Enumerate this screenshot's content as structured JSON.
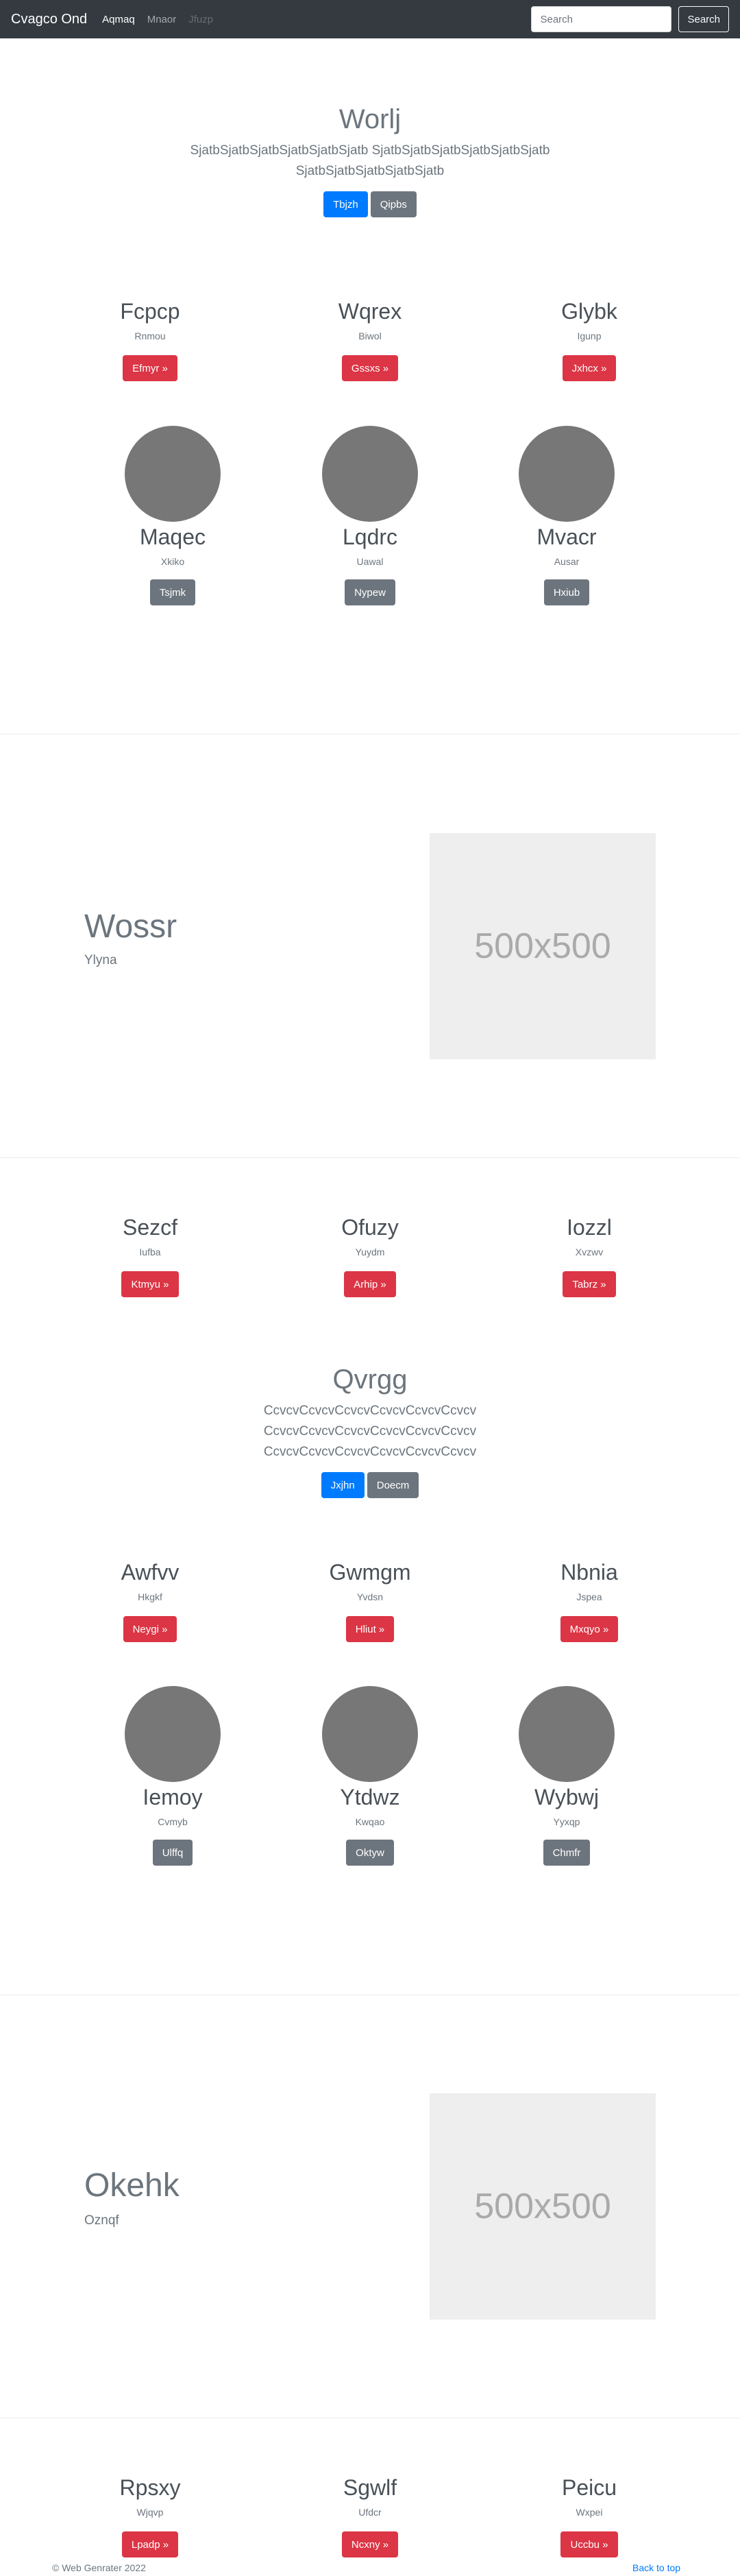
{
  "navbar": {
    "brand": "Cvagco Ond",
    "links": [
      {
        "label": "Aqmaq",
        "state": "active"
      },
      {
        "label": "Mnaor",
        "state": "normal"
      },
      {
        "label": "Jfuzp",
        "state": "disabled"
      }
    ],
    "search_placeholder": "Search",
    "search_button": "Search"
  },
  "jumbotron1": {
    "title": "Worlj",
    "lead": "SjatbSjatbSjatbSjatbSjatbSjatb SjatbSjatbSjatbSjatbSjatbSjatb SjatbSjatbSjatbSjatbSjatb",
    "primary_button": "Tbjzh",
    "secondary_button": "Qipbs"
  },
  "columns1": [
    {
      "title": "Fcpcp",
      "subtitle": "Rnmou",
      "button": "Efmyr »"
    },
    {
      "title": "Wqrex",
      "subtitle": "Biwol",
      "button": "Gssxs »"
    },
    {
      "title": "Glybk",
      "subtitle": "Igunp",
      "button": "Jxhcx »"
    }
  ],
  "marketing1": [
    {
      "title": "Maqec",
      "subtitle": "Xkiko",
      "button": "Tsjmk"
    },
    {
      "title": "Lqdrc",
      "subtitle": "Uawal",
      "button": "Nypew"
    },
    {
      "title": "Mvacr",
      "subtitle": "Ausar",
      "button": "Hxiub"
    }
  ],
  "featurette1": {
    "title": "Wossr",
    "subtitle": "Ylyna",
    "image_label": "500x500"
  },
  "columns2": [
    {
      "title": "Sezcf",
      "subtitle": "Iufba",
      "button": "Ktmyu »"
    },
    {
      "title": "Ofuzy",
      "subtitle": "Yuydm",
      "button": "Arhip »"
    },
    {
      "title": "Iozzl",
      "subtitle": "Xvzwv",
      "button": "Tabrz »"
    }
  ],
  "jumbotron2": {
    "title": "Qvrgg",
    "lead": "CcvcvCcvcvCcvcvCcvcvCcvcvCcvcv CcvcvCcvcvCcvcvCcvcvCcvcvCcvcv CcvcvCcvcvCcvcvCcvcvCcvcvCcvcv",
    "primary_button": "Jxjhn",
    "secondary_button": "Doecm"
  },
  "columns3": [
    {
      "title": "Awfvv",
      "subtitle": "Hkgkf",
      "button": "Neygi »"
    },
    {
      "title": "Gwmgm",
      "subtitle": "Yvdsn",
      "button": "Hliut »"
    },
    {
      "title": "Nbnia",
      "subtitle": "Jspea",
      "button": "Mxqyo »"
    }
  ],
  "marketing2": [
    {
      "title": "Iemoy",
      "subtitle": "Cvmyb",
      "button": "Ulffq"
    },
    {
      "title": "Ytdwz",
      "subtitle": "Kwqao",
      "button": "Oktyw"
    },
    {
      "title": "Wybwj",
      "subtitle": "Yyxqp",
      "button": "Chmfr"
    }
  ],
  "featurette2": {
    "title": "Okehk",
    "subtitle": "Oznqf",
    "image_label": "500x500"
  },
  "columns4": [
    {
      "title": "Rpsxy",
      "subtitle": "Wjqvp",
      "button": "Lpadp »"
    },
    {
      "title": "Sgwlf",
      "subtitle": "Ufdcr",
      "button": "Ncxny »"
    },
    {
      "title": "Peicu",
      "subtitle": "Wxpei",
      "button": "Uccbu »"
    }
  ],
  "footer": {
    "copyright": "© Web Genrater 2022",
    "back_to_top": "Back to top"
  },
  "colors": {
    "navbar": "#343a40",
    "primary": "#007bff",
    "secondary": "#6c757d",
    "danger": "#dc3545",
    "placeholder_img": "#eeeeee",
    "circle": "#777777"
  }
}
